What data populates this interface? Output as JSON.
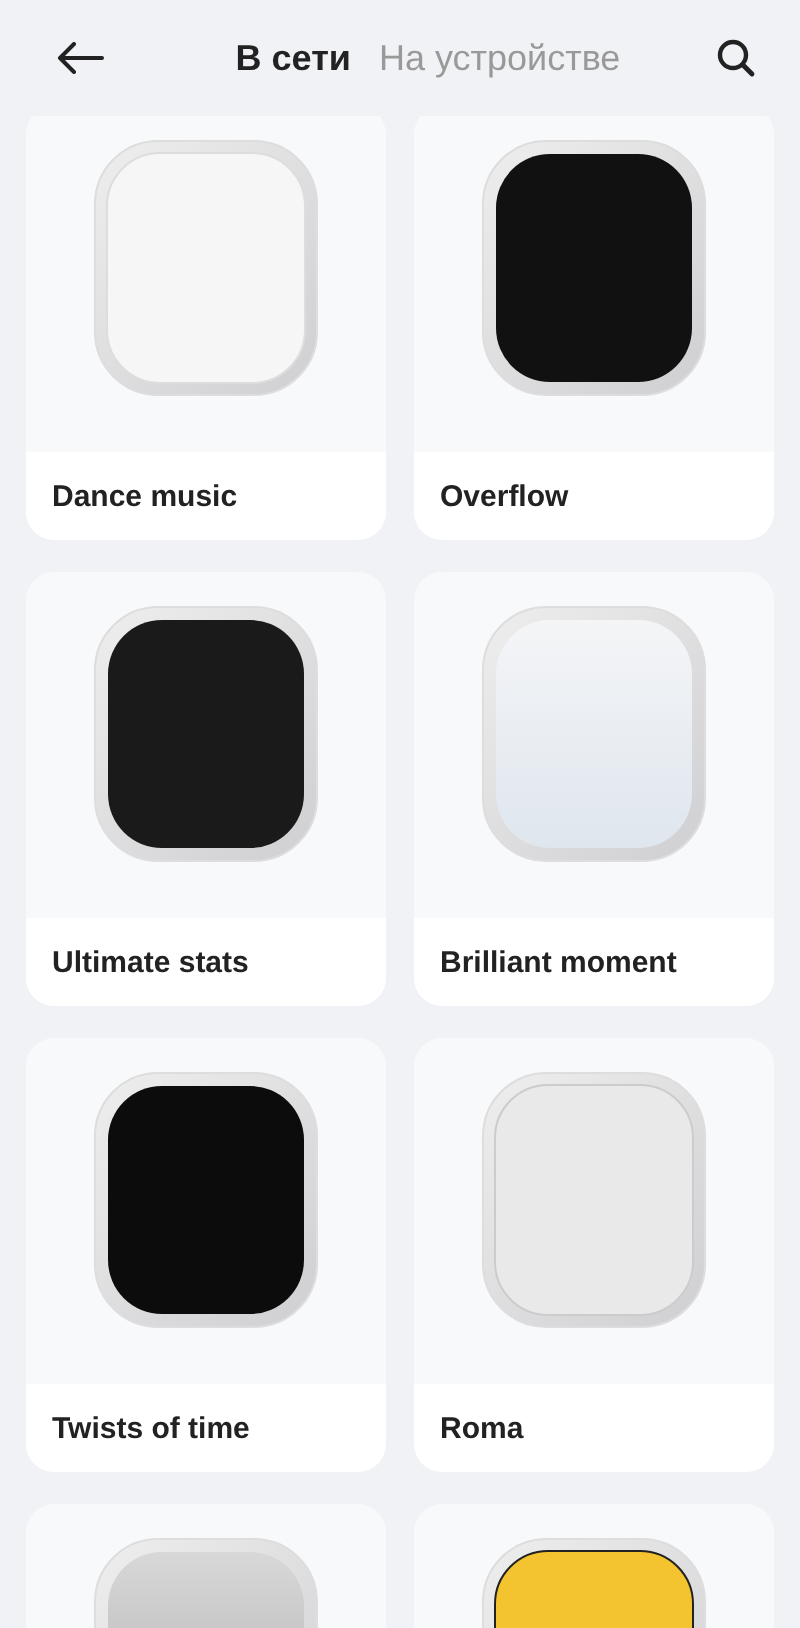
{
  "header": {
    "tabs": [
      {
        "label": "В сети",
        "selected": true
      },
      {
        "label": "На устройстве",
        "selected": false
      }
    ]
  },
  "watch_faces": [
    {
      "kind": "full",
      "title": "Dance music"
    },
    {
      "kind": "full",
      "title": "Overflow"
    },
    {
      "kind": "full",
      "title": "Ultimate stats"
    },
    {
      "kind": "full",
      "title": "Brilliant moment"
    },
    {
      "kind": "full",
      "title": "Twists of time"
    },
    {
      "kind": "full",
      "title": "Roma"
    },
    {
      "kind": "cut"
    },
    {
      "kind": "cut"
    }
  ]
}
